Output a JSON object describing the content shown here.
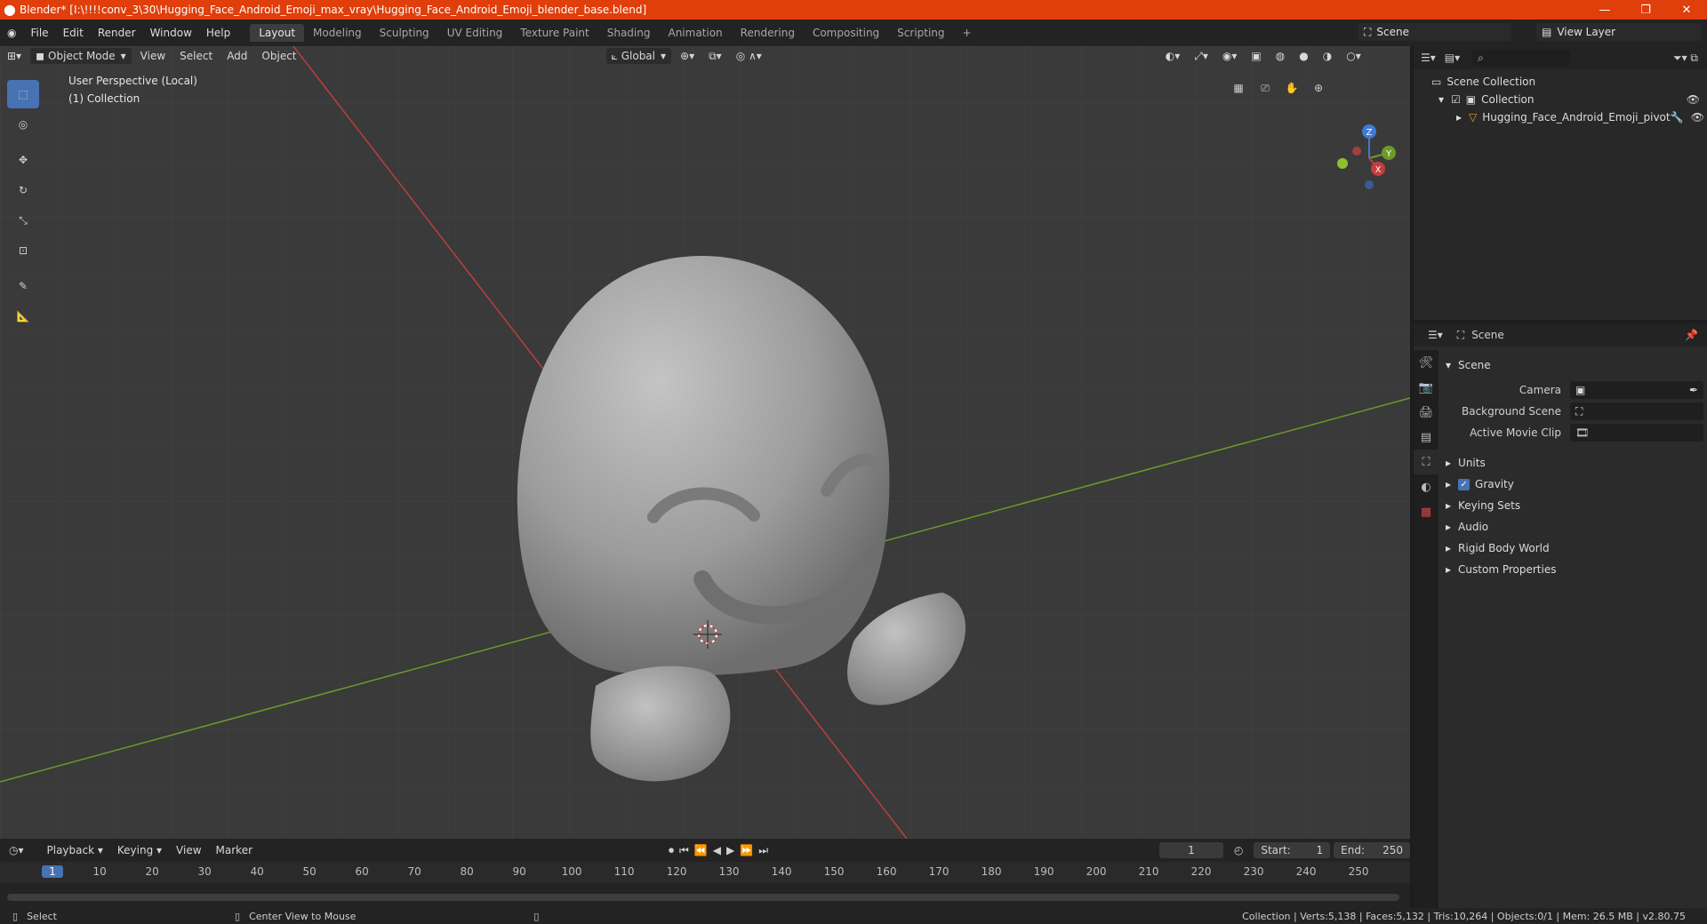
{
  "window": {
    "title": "Blender* [I:\\!!!!conv_3\\30\\Hugging_Face_Android_Emoji_max_vray\\Hugging_Face_Android_Emoji_blender_base.blend]"
  },
  "menu": [
    "File",
    "Edit",
    "Render",
    "Window",
    "Help"
  ],
  "workspaces": [
    "Layout",
    "Modeling",
    "Sculpting",
    "UV Editing",
    "Texture Paint",
    "Shading",
    "Animation",
    "Rendering",
    "Compositing",
    "Scripting"
  ],
  "scene_name": "Scene",
  "view_layer_name": "View Layer",
  "viewport": {
    "mode": "Object Mode",
    "menus": [
      "View",
      "Select",
      "Add",
      "Object"
    ],
    "orientation": "Global",
    "perspective_label": "User Perspective (Local)",
    "collection_label": "(1) Collection",
    "gizmo": {
      "z": "Z",
      "y": "Y",
      "x": "X"
    }
  },
  "outliner": {
    "root": "Scene Collection",
    "collection": "Collection",
    "object": "Hugging_Face_Android_Emoji_pivot"
  },
  "properties": {
    "context": "Scene",
    "panel_title": "Scene",
    "fields": {
      "camera_label": "Camera",
      "background_scene_label": "Background Scene",
      "active_movie_clip_label": "Active Movie Clip"
    },
    "subpanels": [
      "Units",
      "Gravity",
      "Keying Sets",
      "Audio",
      "Rigid Body World",
      "Custom Properties"
    ]
  },
  "timeline": {
    "menus": [
      "Playback",
      "Keying",
      "View",
      "Marker"
    ],
    "current_frame": "1",
    "start_label": "Start:",
    "start_value": "1",
    "end_label": "End:",
    "end_value": "250",
    "ruler": [
      "1",
      "10",
      "20",
      "30",
      "40",
      "50",
      "60",
      "70",
      "80",
      "90",
      "100",
      "110",
      "120",
      "130",
      "140",
      "150",
      "160",
      "170",
      "180",
      "190",
      "200",
      "210",
      "220",
      "230",
      "240",
      "250"
    ]
  },
  "statusbar": {
    "left_action": "Select",
    "mid_action": "Center View to Mouse",
    "stats": "Collection | Verts:5,138 | Faces:5,132 | Tris:10,264 | Objects:0/1 | Mem: 26.5 MB | v2.80.75"
  },
  "colors": {
    "titlebar": "#e03e0b",
    "accent": "#4772b3",
    "x_axis": "#c43d3d",
    "y_axis": "#6b9b2a"
  }
}
